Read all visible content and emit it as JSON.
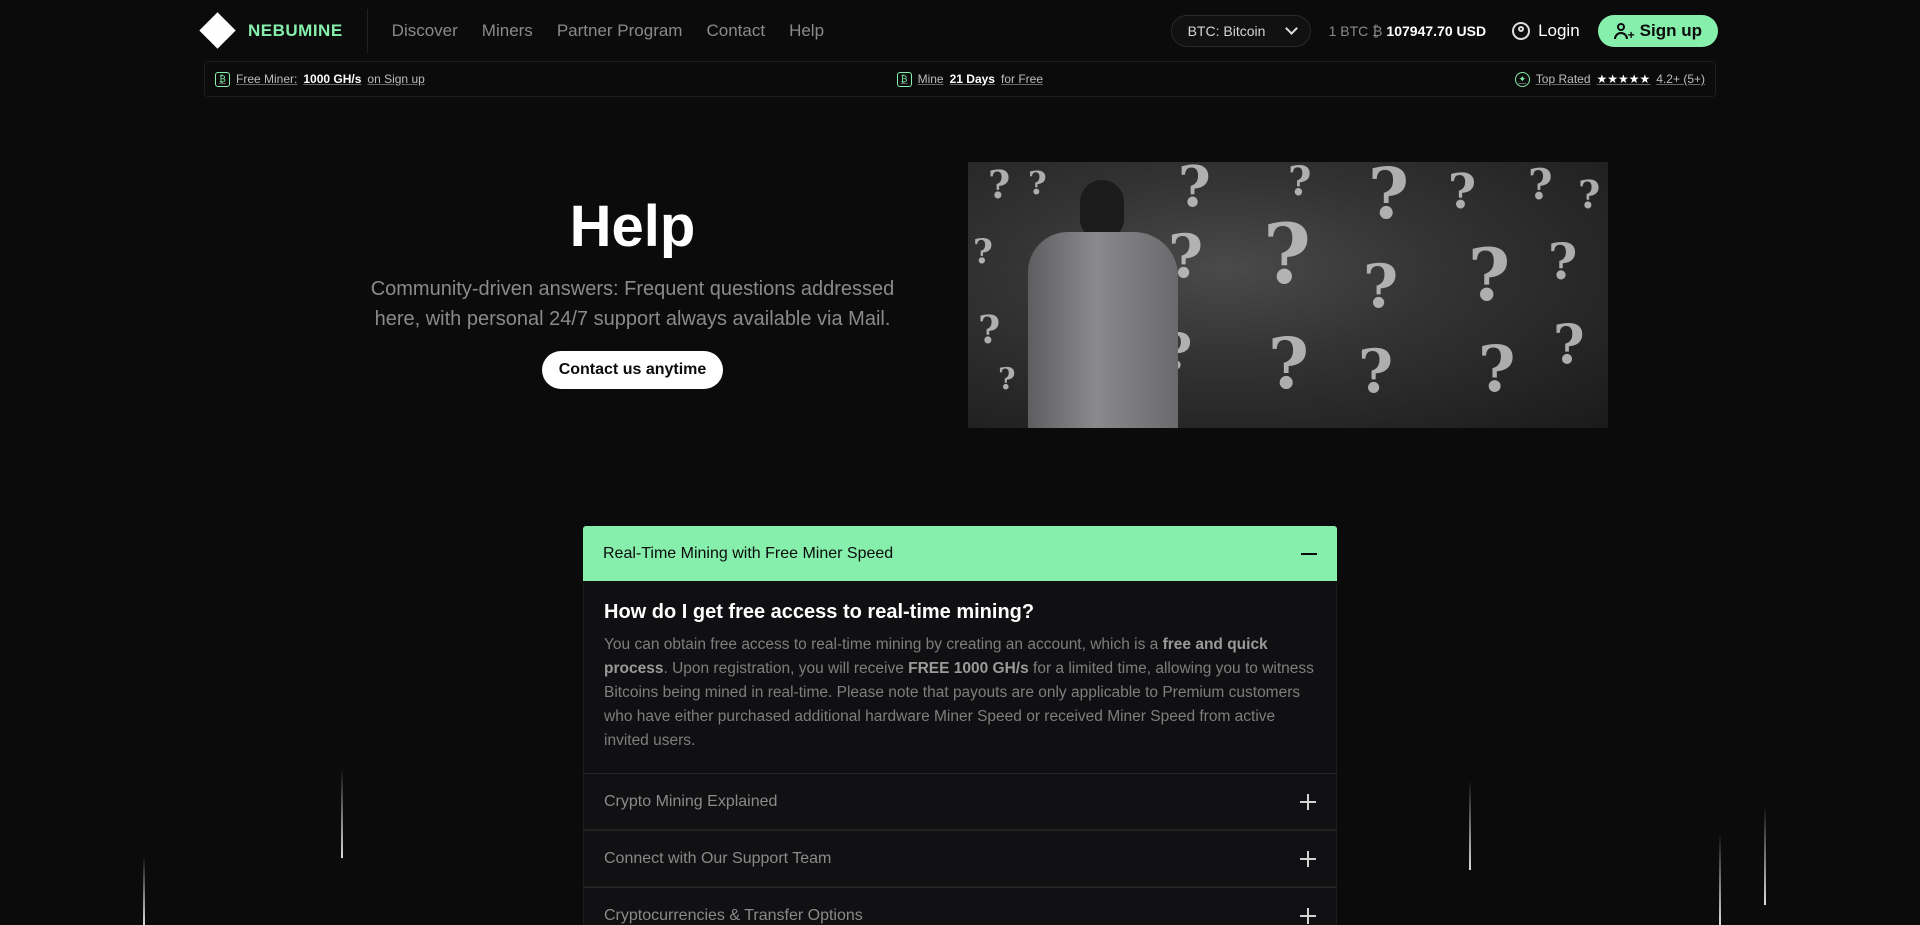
{
  "brand": {
    "name": "NEBUMINE"
  },
  "nav": [
    "Discover",
    "Miners",
    "Partner Program",
    "Contact",
    "Help"
  ],
  "coin_select": {
    "value": "BTC: Bitcoin"
  },
  "price": {
    "prefix": "1 BTC ₿",
    "value": "107947.70 USD"
  },
  "login_label": "Login",
  "signup_label": "Sign up",
  "perks": {
    "free_miner": {
      "pre": "Free Miner:",
      "bold": "1000 GH/s",
      "post": "on Sign up"
    },
    "mine_days": {
      "pre": "Mine",
      "bold": "21 Days",
      "post": "for Free"
    },
    "top_rated": {
      "pre": "Top Rated",
      "stars": "★★★★★",
      "post": "4.2+ (5+)"
    }
  },
  "hero": {
    "title": "Help",
    "subtitle": "Community-driven answers: Frequent questions addressed here, with personal 24/7 support always available via Mail.",
    "button": "Contact us anytime"
  },
  "faq": {
    "open": {
      "title": "Real-Time Mining with Free Miner Speed",
      "question": "How do I get free access to real-time mining?",
      "answer": {
        "p1": "You can obtain free access to real-time mining by creating an account, which is a ",
        "b1": "free and quick process",
        "p2": ". Upon registration, you will receive ",
        "b2": "FREE 1000 GH/s",
        "p3": " for a limited time, allowing you to witness Bitcoins being mined in real-time. Please note that payouts are only applicable to Premium customers who have either purchased additional hardware Miner Speed or received Miner Speed from active invited users."
      }
    },
    "items": [
      "Crypto Mining Explained",
      "Connect with Our Support Team",
      "Cryptocurrencies & Transfer Options"
    ]
  }
}
